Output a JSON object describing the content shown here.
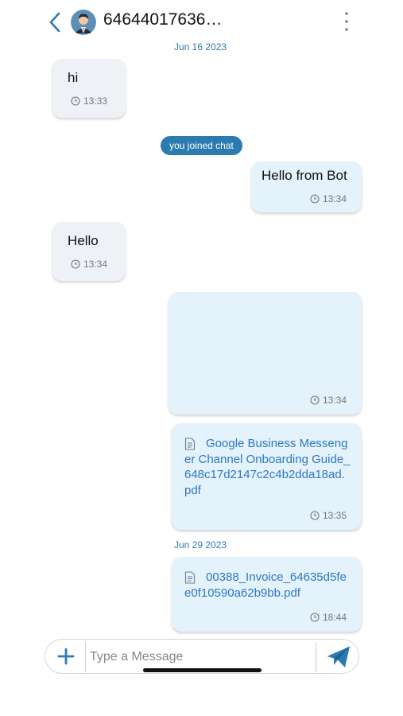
{
  "header": {
    "contact_name": "64644017636…"
  },
  "date_separators": [
    "Jun 16 2023",
    "Jun 29 2023"
  ],
  "messages": [
    {
      "direction": "in",
      "text": "hi",
      "time": "13:33"
    },
    {
      "direction": "system",
      "text": "you joined chat"
    },
    {
      "direction": "out",
      "text": "Hello from Bot",
      "time": "13:34"
    },
    {
      "direction": "in",
      "text": "Hello",
      "time": "13:34"
    },
    {
      "direction": "out",
      "text": "",
      "time": "13:34"
    },
    {
      "direction": "out",
      "file": "Google Business Messenger Channel Onboarding Guide_648c17d2147c2c4b2dda18ad.pdf",
      "time": "13:35"
    },
    {
      "direction": "out",
      "file": "00388_Invoice_64635d5fee0f10590a62b9bb.pdf",
      "time": "18:44"
    }
  ],
  "composer": {
    "placeholder": "Type a Message"
  },
  "colors": {
    "accent": "#2b7bb0",
    "incoming_bubble": "#eef2f7",
    "outgoing_bubble": "#e3f2fb",
    "file_link": "#2e78c5"
  },
  "icons": {
    "back": "chevron-left-icon",
    "menu": "more-vertical-icon",
    "time": "clock-icon",
    "file": "document-icon",
    "add": "plus-icon",
    "send": "paper-plane-icon"
  }
}
